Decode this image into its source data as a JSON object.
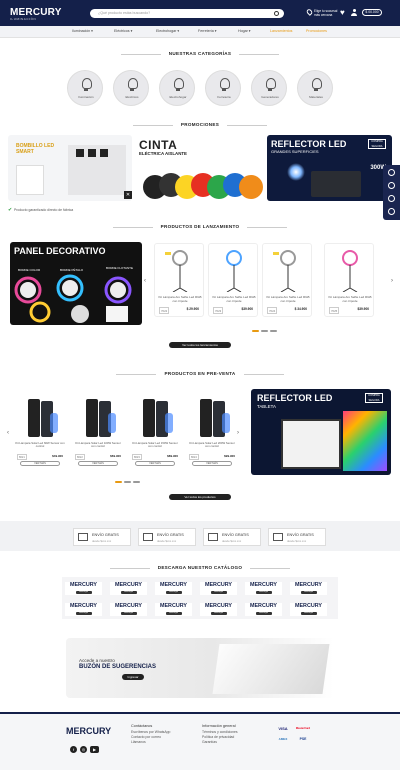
{
  "header": {
    "logo": "MERCURY",
    "logo_sub": "ILUMINACIÓN",
    "search_placeholder": "¿Qué producto estás buscando?",
    "location": "Elige tu sucursal más cercana",
    "cart_total": "$ 00.000"
  },
  "nav": [
    {
      "label": "Iluminación ▾",
      "highlight": false
    },
    {
      "label": "Eléctricos ▾",
      "highlight": false
    },
    {
      "label": "Electrohogar ▾",
      "highlight": false
    },
    {
      "label": "Ferretería ▾",
      "highlight": false
    },
    {
      "label": "Hogar ▾",
      "highlight": false
    },
    {
      "label": "Lanzamientos",
      "highlight": true
    },
    {
      "label": "Promociones",
      "highlight": true
    }
  ],
  "categories_title": "NUESTRAS CATEGORÍAS",
  "categories": [
    "Iluminación",
    "Eléctricos",
    "Electrohogar",
    "Ferretería",
    "Generadores",
    "Materiales"
  ],
  "promos_title": "PROMOCIONES",
  "promos": {
    "p1": "BOMBILLO LED SMART",
    "p2_title": "CINTA",
    "p2_sub": "ELÉCTRICA AISLANTE",
    "p3_title": "REFLECTOR LED",
    "p3_sub": "GRANDES SUPERFICIES",
    "p3_watts": "300W",
    "badge": "COMPRA SEGURA"
  },
  "check_note": "Producto garantizado directo de fábrica",
  "launch_title": "PRODUCTOS DE LANZAMIENTO",
  "launch_banner": {
    "title": "PANEL DECORATIVO",
    "labels": [
      "BORDE COLOR",
      "BORDE PÉTALO",
      "BORDE FLOTANTE"
    ]
  },
  "launch_products": [
    {
      "name": "Kit Lámpara Aro Selfie Led RGB con trípode",
      "code": "7022",
      "price": "$ 29.900"
    },
    {
      "name": "Kit Lámpara Aro Selfie Led RGB con trípode",
      "code": "7023",
      "price": "$39.900"
    },
    {
      "name": "Kit Lámpara Aro Selfie Led RGB con trípode",
      "code": "7024",
      "price": "$ 34.900"
    },
    {
      "name": "Kit Lámpara Aro Selfie Led RGB con trípode",
      "code": "7025",
      "price": "$39.900"
    }
  ],
  "launch_button": "Ver todos los lanzamientos",
  "presale_title": "PRODUCTOS EN PRE-VENTA",
  "presale_products": [
    {
      "name": "Kit Lámpara Solar Led 60W Sensor con control",
      "code": "8021",
      "price": "$49.900",
      "button": "VER MÁS"
    },
    {
      "name": "Kit Lámpara Solar Led 100W Sensor con control",
      "code": "8022",
      "price": "$69.900",
      "button": "VER MÁS"
    },
    {
      "name": "Kit Lámpara Solar Led 150W Sensor con control",
      "code": "8023",
      "price": "$89.900",
      "button": "VER MÁS"
    },
    {
      "name": "Kit Lámpara Solar Led 200W Sensor con control",
      "code": "8024",
      "price": "$99.900",
      "button": "VER MÁS"
    }
  ],
  "presale_banner": {
    "title": "REFLECTOR LED",
    "sub": "TABLETA"
  },
  "presale_button": "Ver todos los productos",
  "shipping": [
    {
      "t1": "ENVÍO GRATIS",
      "t2": "desde $xxx.xxx"
    },
    {
      "t1": "ENVÍO GRATIS",
      "t2": "desde $xxx.xxx"
    },
    {
      "t1": "ENVÍO GRATIS",
      "t2": "desde $xxx.xxx"
    },
    {
      "t1": "ENVÍO GRATIS",
      "t2": "desde $xxx.xxx"
    }
  ],
  "catalog_title": "DESCARGA NUESTRO CATÁLOGO",
  "catalog_logo": "MERCURY",
  "catalog_btn": "Descargar",
  "suggestion": {
    "line1": "Accede a nuestro",
    "line2": "BUZÓN DE SUGERENCIAS",
    "button": "Ingresar"
  },
  "footer": {
    "logo": "MERCURY",
    "col1_head": "Contáctanos",
    "col1": [
      "Escríbenos por WhatsApp",
      "Contacto por correo",
      "Llámanos"
    ],
    "col2_head": "Información general",
    "col2": [
      "Términos y condiciones",
      "Política de privacidad",
      "Garantías"
    ],
    "pay": [
      "VISA",
      "MasterCard",
      "AMEX",
      "PSE"
    ]
  }
}
